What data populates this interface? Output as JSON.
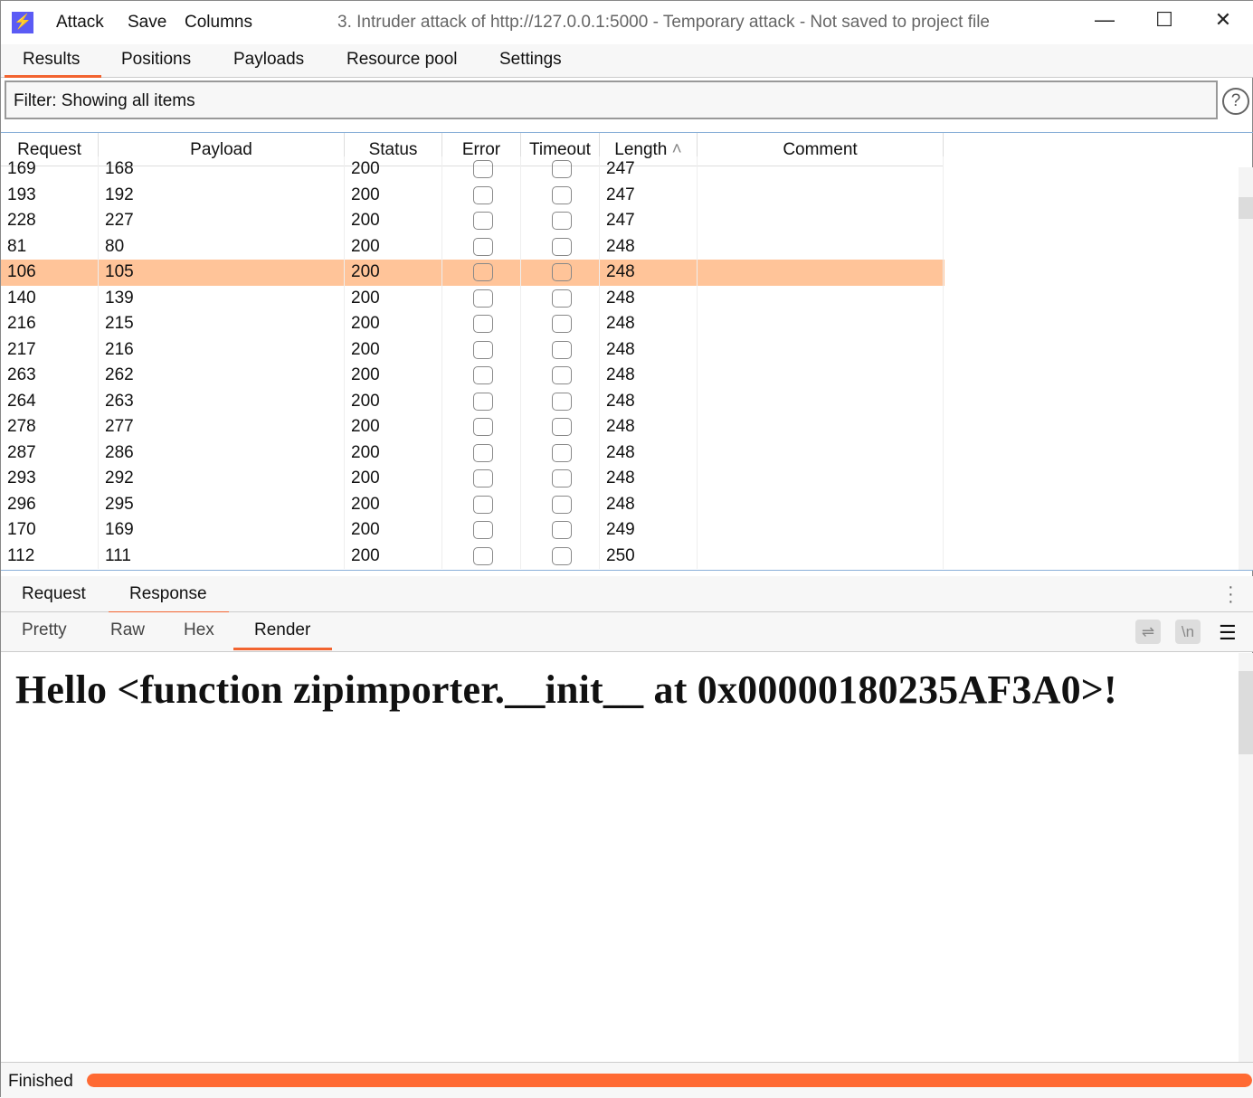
{
  "app": {
    "title": "3. Intruder attack of http://127.0.0.1:5000 - Temporary attack - Not saved to project file",
    "menu": [
      "Attack",
      "Save",
      "Columns"
    ],
    "logo_icon": "lightning-icon"
  },
  "tabs": [
    "Results",
    "Positions",
    "Payloads",
    "Resource pool",
    "Settings"
  ],
  "active_tab": "Results",
  "filter": {
    "text": "Filter: Showing all items"
  },
  "table": {
    "columns": [
      "Request",
      "Payload",
      "Status",
      "Error",
      "Timeout",
      "Length",
      "Comment"
    ],
    "sort": {
      "column": "Length",
      "direction": "ascending"
    },
    "selected_request": "106",
    "rows": [
      [
        "169",
        "168",
        "200",
        false,
        false,
        "247",
        ""
      ],
      [
        "193",
        "192",
        "200",
        false,
        false,
        "247",
        ""
      ],
      [
        "228",
        "227",
        "200",
        false,
        false,
        "247",
        ""
      ],
      [
        "81",
        "80",
        "200",
        false,
        false,
        "248",
        ""
      ],
      [
        "106",
        "105",
        "200",
        false,
        false,
        "248",
        ""
      ],
      [
        "140",
        "139",
        "200",
        false,
        false,
        "248",
        ""
      ],
      [
        "216",
        "215",
        "200",
        false,
        false,
        "248",
        ""
      ],
      [
        "217",
        "216",
        "200",
        false,
        false,
        "248",
        ""
      ],
      [
        "263",
        "262",
        "200",
        false,
        false,
        "248",
        ""
      ],
      [
        "264",
        "263",
        "200",
        false,
        false,
        "248",
        ""
      ],
      [
        "278",
        "277",
        "200",
        false,
        false,
        "248",
        ""
      ],
      [
        "287",
        "286",
        "200",
        false,
        false,
        "248",
        ""
      ],
      [
        "293",
        "292",
        "200",
        false,
        false,
        "248",
        ""
      ],
      [
        "296",
        "295",
        "200",
        false,
        false,
        "248",
        ""
      ],
      [
        "170",
        "169",
        "200",
        false,
        false,
        "249",
        ""
      ],
      [
        "112",
        "111",
        "200",
        false,
        false,
        "250",
        ""
      ]
    ]
  },
  "message_tabs": [
    "Request",
    "Response"
  ],
  "active_message_tab": "Response",
  "view_tabs": [
    "Pretty",
    "Raw",
    "Hex",
    "Render"
  ],
  "active_view_tab": "Render",
  "view_icons": {
    "wrap": "word-wrap-icon",
    "newline": "\\n",
    "menu": "hamburger-icon"
  },
  "render": {
    "text": "Hello <function zipimporter.__init__ at 0x00000180235AF3A0>!"
  },
  "status": {
    "text": "Finished",
    "progress_percent": 100
  },
  "colors": {
    "accent": "#f26430",
    "selected_row": "#ffc499",
    "progress": "#ff6a33",
    "logo": "#5b5bf5"
  }
}
